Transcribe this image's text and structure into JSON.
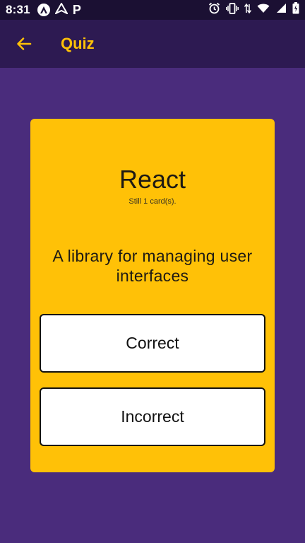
{
  "status_bar": {
    "time": "8:31",
    "left_icons": [
      "react-native-icon",
      "navigation-icon",
      "p-icon"
    ],
    "p_glyph": "P",
    "right_icons": [
      "alarm-icon",
      "vibrate-icon",
      "data-arrows-icon",
      "wifi-icon",
      "signal-icon",
      "battery-icon"
    ]
  },
  "app_bar": {
    "title": "Quiz",
    "back_icon": "arrow-back-icon"
  },
  "quiz": {
    "deck_title": "React",
    "cards_remaining": "Still 1 card(s).",
    "question": "A library for managing user interfaces",
    "correct_label": "Correct",
    "incorrect_label": "Incorrect"
  },
  "colors": {
    "background": "#4a2c7c",
    "app_bar": "#2d1a52",
    "status_bar": "#1b1033",
    "accent": "#ffc107",
    "button_bg": "#ffffff"
  }
}
